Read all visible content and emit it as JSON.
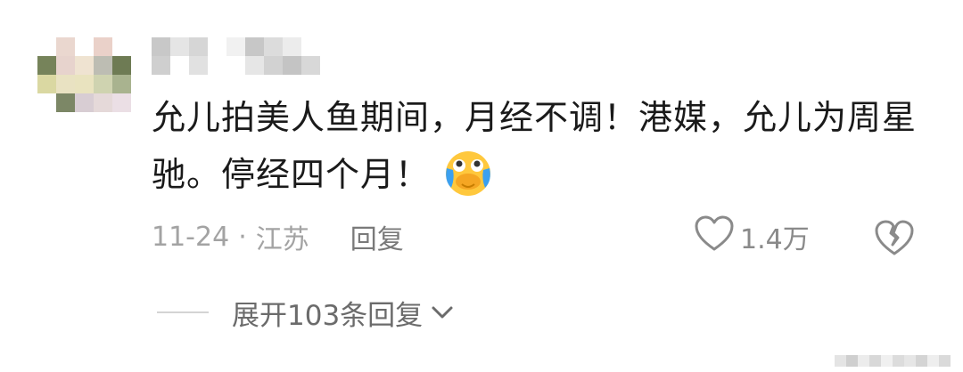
{
  "comment": {
    "username_hidden": true,
    "text": "允儿拍美人鱼期间，月经不调！港媒，允儿为周星驰。停经四个月！",
    "emoji": "crying-laughing-emoji",
    "date": "11-24",
    "separator": "·",
    "location": "江苏",
    "reply_label": "回复",
    "like_count": "1.4万",
    "expand_label": "展开103条回复"
  },
  "colors": {
    "text": "#1a1a1a",
    "meta": "#a3a3a3",
    "reply": "#7a7a7a",
    "icon": "#8a8a8a"
  },
  "avatar_pixels": [
    "#ffffff",
    "#ead7cf",
    "#ffffff",
    "#ead1c9",
    "#ffffff",
    "#76835a",
    "#e7d3cd",
    "#efe3d1",
    "#bdbdb3",
    "#6e7b54",
    "#dad8a2",
    "#e9e2c2",
    "#e9e3bf",
    "#cfd3b0",
    "#a9b38f",
    "#ffffff",
    "#7c8766",
    "#d8cdd3",
    "#e5d9d9",
    "#ebdfe5"
  ],
  "username_pixels": [
    "#c8c8c8",
    "#e5e5e5",
    "#d6d6d6",
    "#ffffff",
    "#f1f1f1",
    "#c7c7c7",
    "#dcdcdc",
    "#ececec",
    "#ffffff",
    "#cfcfcf",
    "#ffffff",
    "#e1e1e1",
    "#ffffff",
    "#ffffff",
    "#e6e6e6",
    "#d2d2d2",
    "#c4c4c4",
    "#d8d8d8"
  ],
  "watermark_pixels": [
    "#e4e4e4",
    "#cfcfcf",
    "#ececec",
    "#d8d8d8",
    "#f0f0f0",
    "#dcdcdc",
    "#e6e6e6",
    "#d4d4d4",
    "#eeeeee",
    "#dadada"
  ]
}
